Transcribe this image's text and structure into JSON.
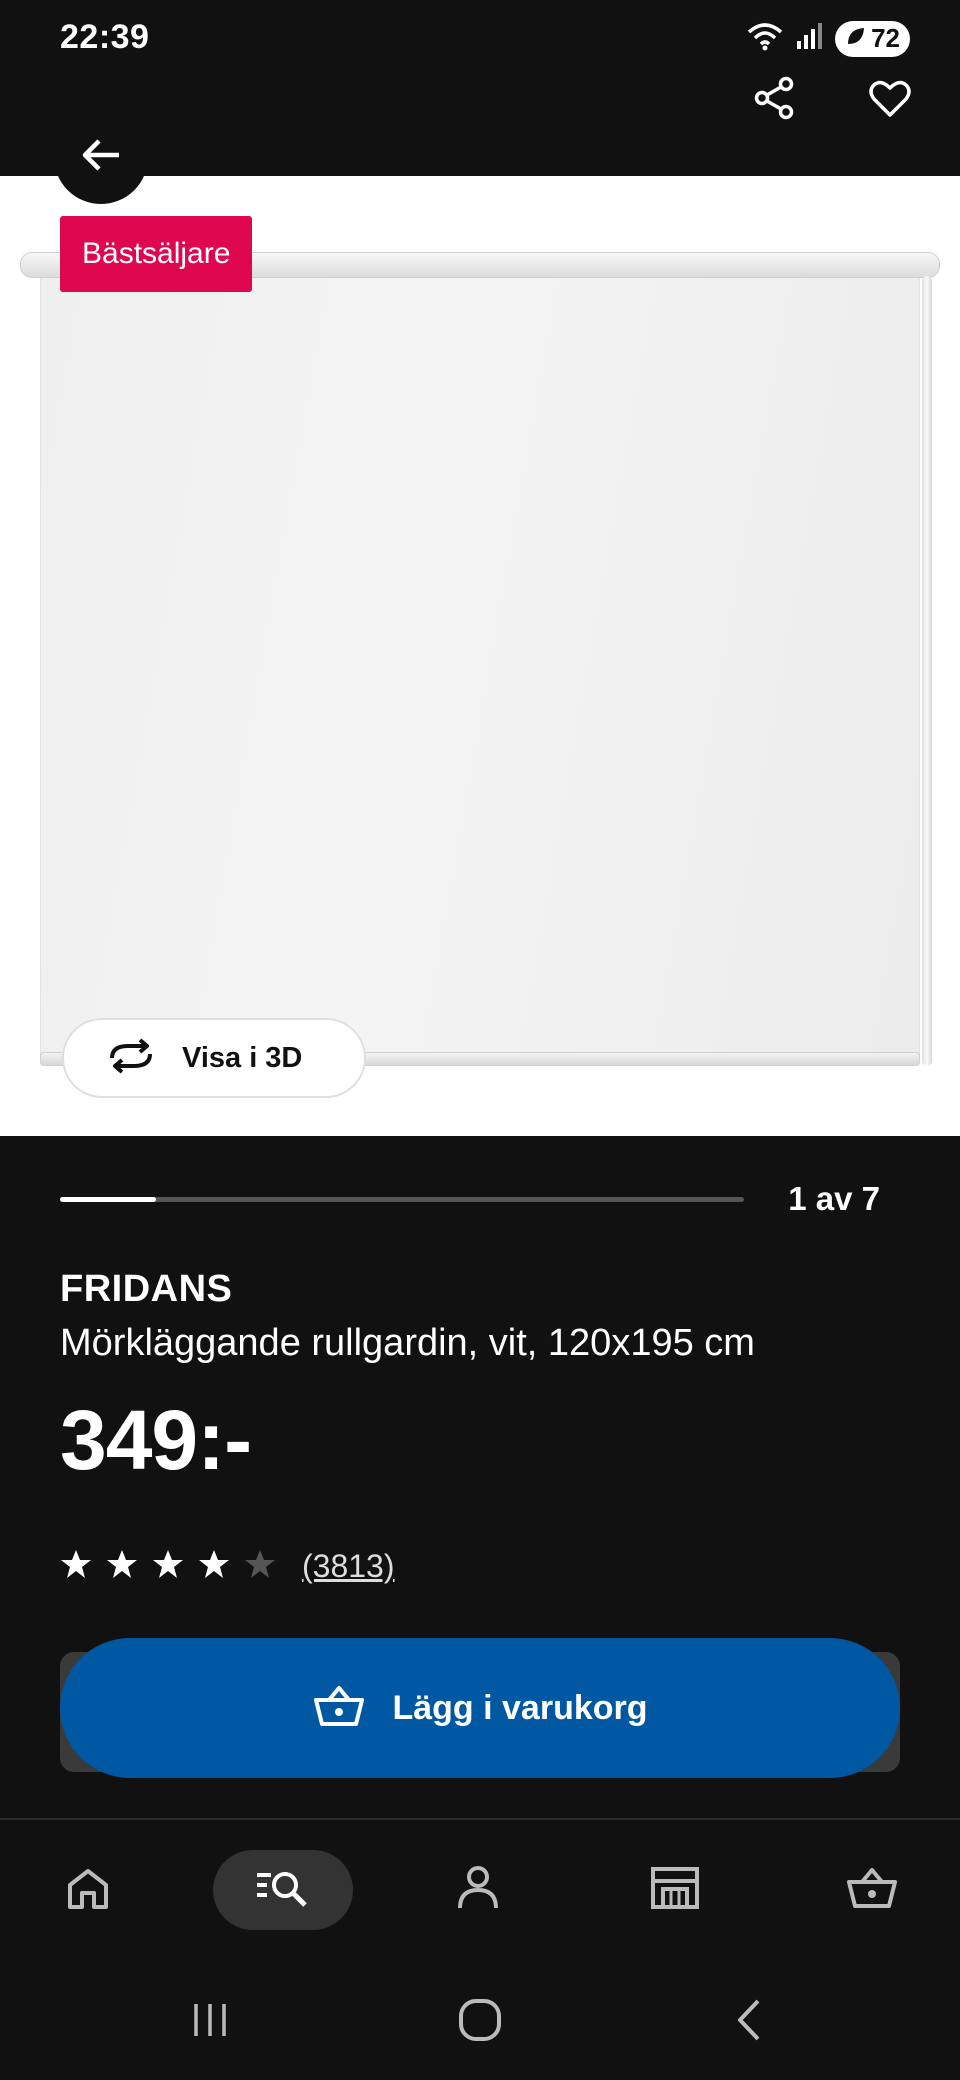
{
  "status_bar": {
    "time": "22:39",
    "battery": "72"
  },
  "top_actions": {
    "share_icon": "share-icon",
    "favorite_icon": "heart-icon"
  },
  "back_icon": "arrow-left-icon",
  "image": {
    "badge": "Bästsäljare",
    "view3d_label": "Visa i 3D"
  },
  "carousel": {
    "current": 1,
    "total": 7,
    "counter_text": "1 av 7",
    "progress": 0.14
  },
  "product": {
    "name": "FRIDANS",
    "description": "Mörkläggande rullgardin, vit, 120x195 cm",
    "price": "349:-",
    "rating": 4,
    "rating_max": 5,
    "review_count": "(3813)"
  },
  "cart_button": {
    "label": "Lägg i varukorg",
    "color": "#0058a3"
  },
  "badge_color": "#e00751",
  "bottom_nav": {
    "items": [
      {
        "name": "home",
        "icon": "home-icon",
        "active": false
      },
      {
        "name": "search",
        "icon": "search-list-icon",
        "active": true
      },
      {
        "name": "profile",
        "icon": "person-icon",
        "active": false
      },
      {
        "name": "stores",
        "icon": "store-icon",
        "active": false
      },
      {
        "name": "cart",
        "icon": "basket-icon",
        "active": false
      }
    ]
  },
  "system_nav": {
    "recents": "recents-icon",
    "home": "home-circle-icon",
    "back": "chevron-left-icon"
  }
}
